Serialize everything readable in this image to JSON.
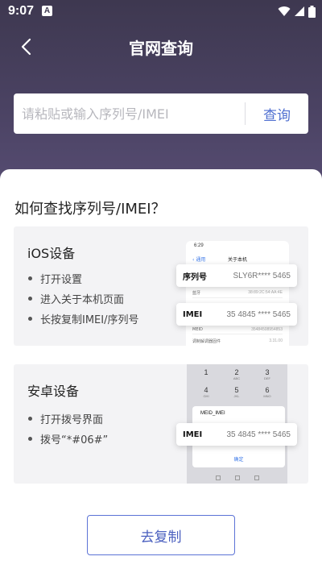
{
  "status_bar": {
    "time": "9:07",
    "notification_badge": "A",
    "icons": [
      "wifi-icon",
      "signal-icon",
      "battery-icon"
    ]
  },
  "header": {
    "title": "官网查询",
    "back_icon": "chevron-left-icon"
  },
  "search": {
    "placeholder": "请粘贴或输入序列号/IMEI",
    "value": "",
    "button_label": "查询"
  },
  "guide": {
    "title": "如何查找序列号/IMEI？",
    "ios": {
      "title": "iOS设备",
      "steps": [
        "打开设置",
        "进入关于本机页面",
        "长按复制IMEI/序列号"
      ],
      "screenshot": {
        "time": "6:29",
        "back": "通用",
        "nav_title": "关于本机",
        "rows": [
          {
            "label": "蓝牙",
            "value": "38:89:2C:54:AA:4E"
          },
          {
            "label": "MEID",
            "value": "35484508954853"
          },
          {
            "label": "调制解调器固件",
            "value": "3.31.00"
          }
        ],
        "serial_label": "序列号",
        "serial_value": "SLY6R**** 5465",
        "imei_label": "IMEI",
        "imei_value": "35 4845 **** 5465"
      }
    },
    "android": {
      "title": "安卓设备",
      "steps": [
        "打开拨号界面",
        "拨号“*#06#”"
      ],
      "screenshot": {
        "keys": [
          {
            "digit": "1",
            "letters": ""
          },
          {
            "digit": "2",
            "letters": "ABC"
          },
          {
            "digit": "3",
            "letters": "DEF"
          },
          {
            "digit": "4",
            "letters": "GHI"
          },
          {
            "digit": "5",
            "letters": "JKL"
          },
          {
            "digit": "6",
            "letters": "MNO"
          }
        ],
        "dialog_title": "MEID_IMEI",
        "imei_label": "IMEI",
        "imei_value": "35 4845 **** 5465",
        "ok_label": "确定"
      }
    }
  },
  "copy_button_label": "去复制",
  "colors": {
    "header_bg": "#3e3850",
    "accent": "#4f6fd0",
    "card_bg": "#f3f3f5"
  }
}
